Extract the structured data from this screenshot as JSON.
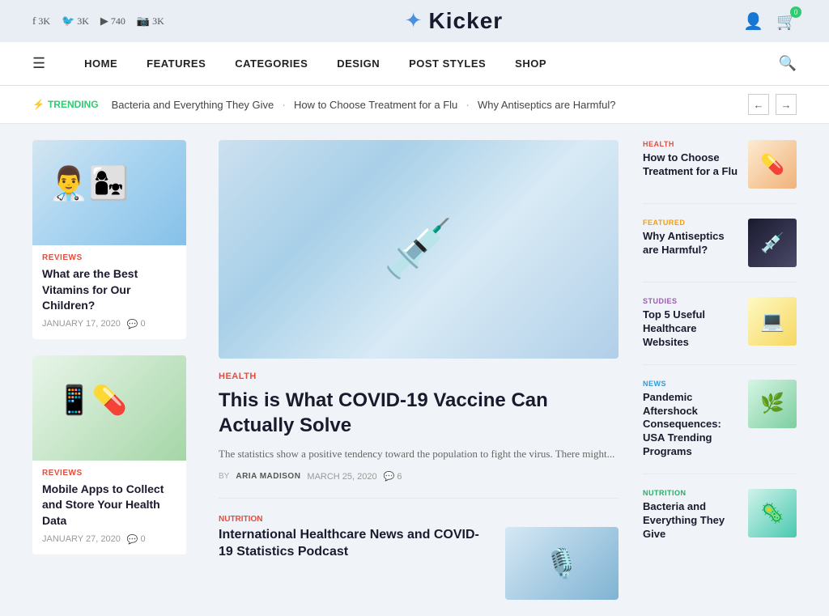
{
  "topbar": {
    "social": [
      {
        "icon": "f",
        "label": "3K",
        "name": "facebook"
      },
      {
        "icon": "🐦",
        "label": "3K",
        "name": "twitter"
      },
      {
        "icon": "▶",
        "label": "740",
        "name": "youtube"
      },
      {
        "icon": "📷",
        "label": "3K",
        "name": "instagram"
      }
    ],
    "logo": "Kicker",
    "cart_count": "0"
  },
  "nav": {
    "items": [
      "HOME",
      "FEATURES",
      "CATEGORIES",
      "DESIGN",
      "POST STYLES",
      "SHOP"
    ]
  },
  "trending": {
    "label": "TRENDING",
    "items": [
      "Bacteria and Everything They Give",
      "How to Choose Treatment for a Flu",
      "Why Antiseptics are Harmful?"
    ]
  },
  "left_articles": [
    {
      "category": "REVIEWS",
      "title": "What are the Best Vitamins for Our Children?",
      "date": "JANUARY 17, 2020",
      "comments": "0"
    },
    {
      "category": "REVIEWS",
      "title": "Mobile Apps to Collect and Store Your Health Data",
      "date": "JANUARY 27, 2020",
      "comments": "0"
    }
  ],
  "featured_article": {
    "category": "HEALTH",
    "title": "This is What COVID-19 Vaccine Can Actually Solve",
    "excerpt": "The statistics show a positive tendency toward the population to fight the virus. There might...",
    "author": "ARIA MADISON",
    "date": "MARCH 25, 2020",
    "comments": "6"
  },
  "second_article": {
    "category": "NUTRITION",
    "title": "International Healthcare News and COVID-19 Statistics Podcast"
  },
  "right_articles": [
    {
      "category": "HEALTH",
      "cat_class": "",
      "title": "How to Choose Treatment for a Flu",
      "thumb_class": "thumb-1",
      "thumb_icon": "💊"
    },
    {
      "category": "FEATURED",
      "cat_class": "featured-color",
      "title": "Why Antiseptics are Harmful?",
      "thumb_class": "thumb-2",
      "thumb_icon": "💉"
    },
    {
      "category": "STUDIES",
      "cat_class": "studies-color",
      "title": "Top 5 Useful Healthcare Websites",
      "thumb_class": "thumb-3",
      "thumb_icon": "💻"
    },
    {
      "category": "NEWS",
      "cat_class": "news-color",
      "title": "Pandemic Aftershock Consequences: USA Trending Programs",
      "thumb_class": "thumb-4",
      "thumb_icon": "🌿"
    },
    {
      "category": "NUTRITION",
      "cat_class": "nutrition-color",
      "title": "Bacteria and Everything They Give",
      "thumb_class": "thumb-5",
      "thumb_icon": "🦠"
    }
  ]
}
